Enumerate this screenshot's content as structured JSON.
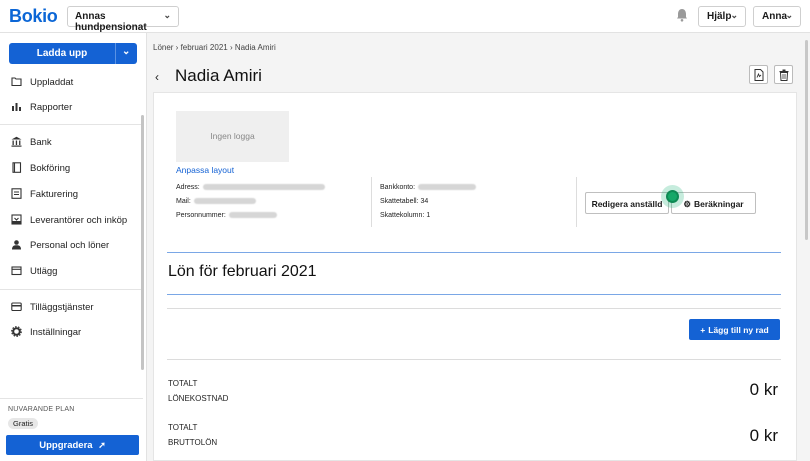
{
  "topbar": {
    "logo": "Bokio",
    "company": "Annas hundpensionat",
    "help": "Hjälp",
    "user": "Anna"
  },
  "sidebar": {
    "upload_label": "Ladda upp",
    "items": [
      {
        "label": "Uppladdat",
        "icon": "folder-icon"
      },
      {
        "label": "Rapporter",
        "icon": "bar-chart-icon"
      },
      {
        "label": "Bank",
        "icon": "bank-icon"
      },
      {
        "label": "Bokföring",
        "icon": "book-icon"
      },
      {
        "label": "Fakturering",
        "icon": "invoice-icon"
      },
      {
        "label": "Leverantörer och inköp",
        "icon": "inbox-icon"
      },
      {
        "label": "Personal och löner",
        "icon": "person-icon"
      },
      {
        "label": "Utlägg",
        "icon": "wallet-icon"
      },
      {
        "label": "Tilläggstjänster",
        "icon": "card-icon"
      },
      {
        "label": "Inställningar",
        "icon": "gear-icon"
      }
    ],
    "plan_label": "NUVARANDE PLAN",
    "plan": "Gratis",
    "upgrade_label": "Uppgradera"
  },
  "breadcrumb": "Löner › februari 2021 › Nadia Amiri",
  "page_title": "Nadia Amiri",
  "card": {
    "logo_placeholder": "Ingen logga",
    "customize_link": "Anpassa layout",
    "info_left": [
      {
        "label": "Adress:"
      },
      {
        "label": "Mail:"
      },
      {
        "label": "Personnummer:"
      }
    ],
    "info_right": [
      {
        "label": "Bankkonto:",
        "value": ""
      },
      {
        "label": "Skattetabell:",
        "value": "34"
      },
      {
        "label": "Skattekolumn:",
        "value": "1"
      }
    ],
    "edit_button": "Redigera anställd",
    "calc_button": "Beräkningar",
    "section_title": "Lön för februari 2021",
    "add_row_button": "Lägg till ny rad",
    "totals": [
      {
        "label_line1": "TOTALT",
        "label_line2": "LÖNEKOSTNAD",
        "value": "0 kr"
      },
      {
        "label_line1": "TOTALT",
        "label_line2": "BRUTTOLÖN",
        "value": "0 kr"
      }
    ]
  },
  "colors": {
    "accent": "#1462d4",
    "pulse": "#15a868"
  }
}
